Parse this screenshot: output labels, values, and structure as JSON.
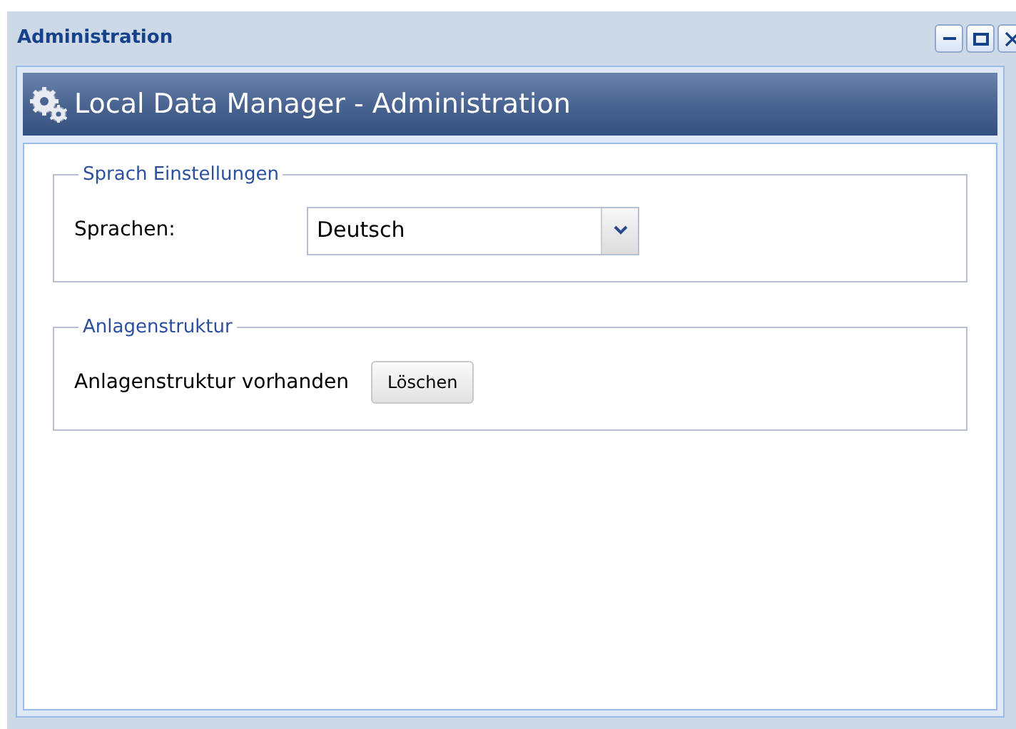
{
  "window": {
    "title": "Administration"
  },
  "header": {
    "title": "Local Data Manager - Administration"
  },
  "sections": [
    {
      "legend": "Sprach Einstellungen",
      "kind": "select",
      "label": "Sprachen:",
      "value": "Deutsch"
    },
    {
      "legend": "Anlagenstruktur",
      "kind": "button",
      "label": "Anlagenstruktur vorhanden",
      "button": "Löschen"
    }
  ]
}
